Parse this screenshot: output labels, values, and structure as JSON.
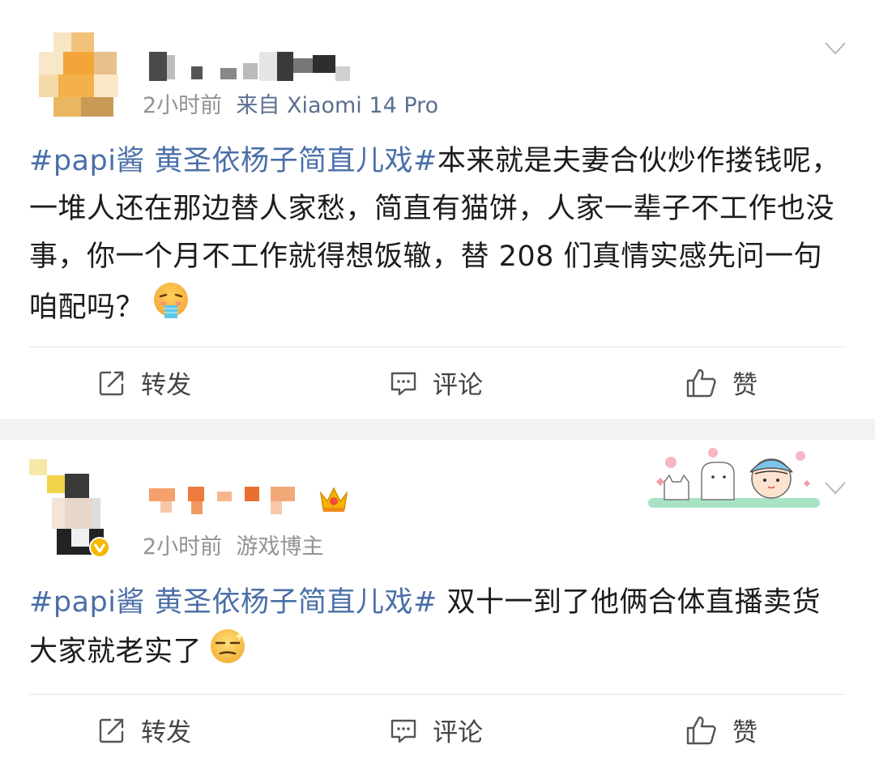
{
  "posts": [
    {
      "time": "2小时前",
      "source": "来自 Xiaomi 14 Pro",
      "topic": "#papi酱 黄圣依杨子简直儿戏#",
      "text": "本来就是夫妻合伙炒作搂钱呢，一堆人还在那边替人家愁，简直有猫饼，人家一辈子不工作也没事，你一个月不工作就得想饭辙，替 208 们真情实感先问一句咱配吗？",
      "emoji": "vomit-face-emoji",
      "actions": {
        "repost": "转发",
        "comment": "评论",
        "like": "赞"
      }
    },
    {
      "time": "2小时前",
      "source": "游戏博主",
      "topic": "#papi酱 黄圣依杨子简直儿戏#",
      "text": " 双十一到了他俩合体直播卖货大家就老实了",
      "emoji": "smirk-face-emoji",
      "actions": {
        "repost": "转发",
        "comment": "评论",
        "like": "赞"
      }
    }
  ],
  "colors": {
    "topic": "#4a6fa8",
    "meta": "#939393",
    "separator": "#f2f2f2",
    "verified": "#f5b800"
  }
}
